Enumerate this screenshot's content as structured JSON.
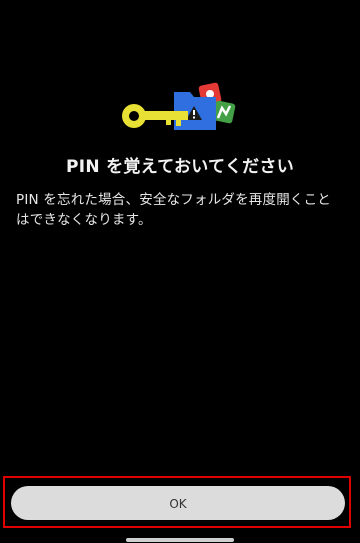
{
  "dialog": {
    "title": "PIN を覚えておいてください",
    "message": "PIN を忘れた場合、安全なフォルダを再度開くことはできなくなります。",
    "ok_label": "OK"
  },
  "illustration": {
    "icons": [
      "key-icon",
      "secure-folder-icon",
      "app-icon-red",
      "app-icon-green"
    ]
  },
  "colors": {
    "background": "#000000",
    "button": "#dcdcdc",
    "highlight": "#e00000",
    "key": "#e8e034",
    "folder": "#2f6fe0"
  }
}
